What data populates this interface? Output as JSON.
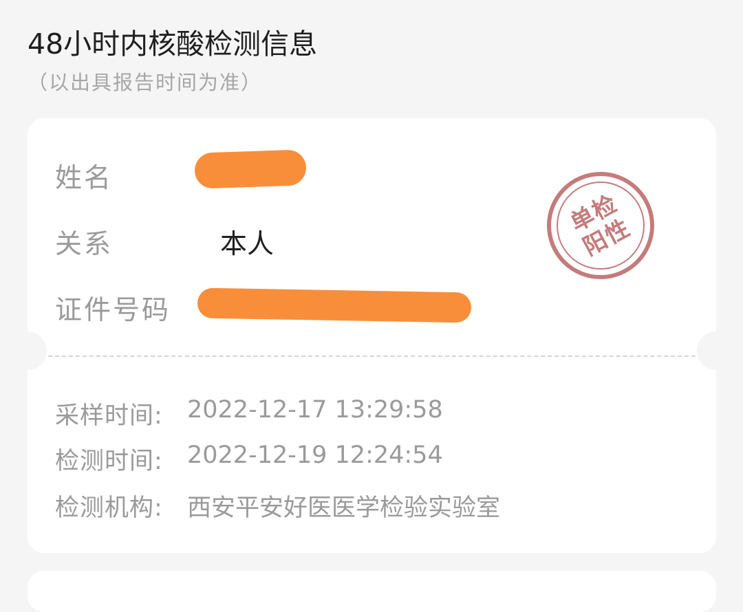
{
  "header": {
    "title": "48小时内核酸检测信息",
    "subtitle": "（以出具报告时间为准）"
  },
  "card": {
    "name": {
      "label": "姓名",
      "value": ""
    },
    "relation": {
      "label": "关系",
      "value": "本人"
    },
    "id_number": {
      "label": "证件号码",
      "value": ""
    },
    "stamp": {
      "line1": "单检",
      "line2": "阳性",
      "color": "#c57b7b"
    },
    "sampling_time": {
      "label": "采样时间:",
      "value": "2022-12-17 13:29:58"
    },
    "test_time": {
      "label": "检测时间:",
      "value": "2022-12-19 12:24:54"
    },
    "test_institution": {
      "label": "检测机构:",
      "value": "西安平安好医医学检验实验室"
    }
  },
  "colors": {
    "background": "#f5f5f5",
    "card": "#ffffff",
    "redaction": "#f98e3a"
  }
}
